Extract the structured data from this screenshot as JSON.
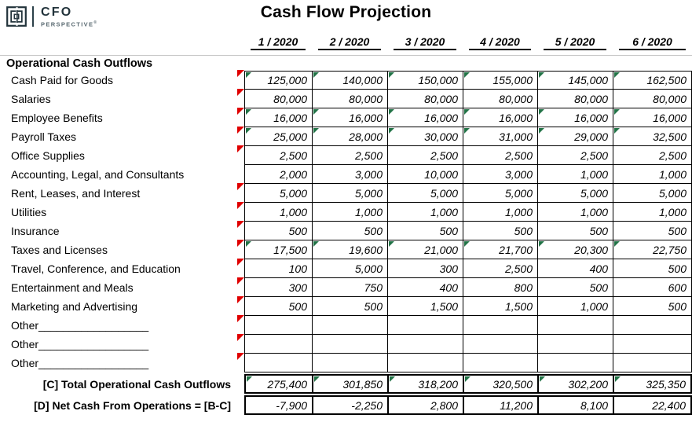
{
  "brand": {
    "name": "CFO",
    "tagline": "PERSPECTIVE",
    "registered": "®",
    "logo_color": "#22333b"
  },
  "title": "Cash Flow Projection",
  "section_title": "Operational Cash Outflows",
  "colors": {
    "comment_marker": "#e00000",
    "error_marker": "#217346",
    "grid_line": "#000000",
    "rule": "#c8c8c8"
  },
  "chart_data": {
    "type": "table",
    "title": "Cash Flow Projection",
    "section": "Operational Cash Outflows",
    "categories": [
      "1 / 2020",
      "2 / 2020",
      "3 / 2020",
      "4 / 2020",
      "5 / 2020",
      "6 / 2020"
    ],
    "rows": [
      {
        "label": "Cash Paid for Goods",
        "values": [
          "125,000",
          "140,000",
          "150,000",
          "155,000",
          "145,000",
          "162,500"
        ],
        "error_marker": true,
        "comment_marker": true
      },
      {
        "label": "Salaries",
        "values": [
          "80,000",
          "80,000",
          "80,000",
          "80,000",
          "80,000",
          "80,000"
        ],
        "error_marker": false,
        "comment_marker": true
      },
      {
        "label": "Employee Benefits",
        "values": [
          "16,000",
          "16,000",
          "16,000",
          "16,000",
          "16,000",
          "16,000"
        ],
        "error_marker": true,
        "comment_marker": true
      },
      {
        "label": "Payroll Taxes",
        "values": [
          "25,000",
          "28,000",
          "30,000",
          "31,000",
          "29,000",
          "32,500"
        ],
        "error_marker": true,
        "comment_marker": true
      },
      {
        "label": "Office Supplies",
        "values": [
          "2,500",
          "2,500",
          "2,500",
          "2,500",
          "2,500",
          "2,500"
        ],
        "error_marker": false,
        "comment_marker": true
      },
      {
        "label": "Accounting, Legal, and Consultants",
        "values": [
          "2,000",
          "3,000",
          "10,000",
          "3,000",
          "1,000",
          "1,000"
        ],
        "error_marker": false,
        "comment_marker": false
      },
      {
        "label": "Rent, Leases, and Interest",
        "values": [
          "5,000",
          "5,000",
          "5,000",
          "5,000",
          "5,000",
          "5,000"
        ],
        "error_marker": false,
        "comment_marker": true
      },
      {
        "label": "Utilities",
        "values": [
          "1,000",
          "1,000",
          "1,000",
          "1,000",
          "1,000",
          "1,000"
        ],
        "error_marker": false,
        "comment_marker": true
      },
      {
        "label": "Insurance",
        "values": [
          "500",
          "500",
          "500",
          "500",
          "500",
          "500"
        ],
        "error_marker": false,
        "comment_marker": true
      },
      {
        "label": "Taxes and Licenses",
        "values": [
          "17,500",
          "19,600",
          "21,000",
          "21,700",
          "20,300",
          "22,750"
        ],
        "error_marker": true,
        "comment_marker": true
      },
      {
        "label": "Travel, Conference, and Education",
        "values": [
          "100",
          "5,000",
          "300",
          "2,500",
          "400",
          "500"
        ],
        "error_marker": false,
        "comment_marker": true
      },
      {
        "label": "Entertainment and Meals",
        "values": [
          "300",
          "750",
          "400",
          "800",
          "500",
          "600"
        ],
        "error_marker": false,
        "comment_marker": true
      },
      {
        "label": "Marketing and Advertising",
        "values": [
          "500",
          "500",
          "1,500",
          "1,500",
          "1,000",
          "500"
        ],
        "error_marker": false,
        "comment_marker": true
      },
      {
        "label": "Other__________________",
        "values": [
          "",
          "",
          "",
          "",
          "",
          ""
        ],
        "error_marker": false,
        "comment_marker": true
      },
      {
        "label": "Other__________________",
        "values": [
          "",
          "",
          "",
          "",
          "",
          ""
        ],
        "error_marker": false,
        "comment_marker": true
      },
      {
        "label": "Other__________________",
        "values": [
          "",
          "",
          "",
          "",
          "",
          ""
        ],
        "error_marker": false,
        "comment_marker": true
      }
    ],
    "total_rows": [
      {
        "label": "[C] Total Operational Cash Outflows",
        "values": [
          "275,400",
          "301,850",
          "318,200",
          "320,500",
          "302,200",
          "325,350"
        ],
        "error_marker": true
      },
      {
        "label": "[D] Net Cash From Operations = [B-C]",
        "values": [
          "-7,900",
          "-2,250",
          "2,800",
          "11,200",
          "8,100",
          "22,400"
        ],
        "error_marker": false
      }
    ]
  }
}
